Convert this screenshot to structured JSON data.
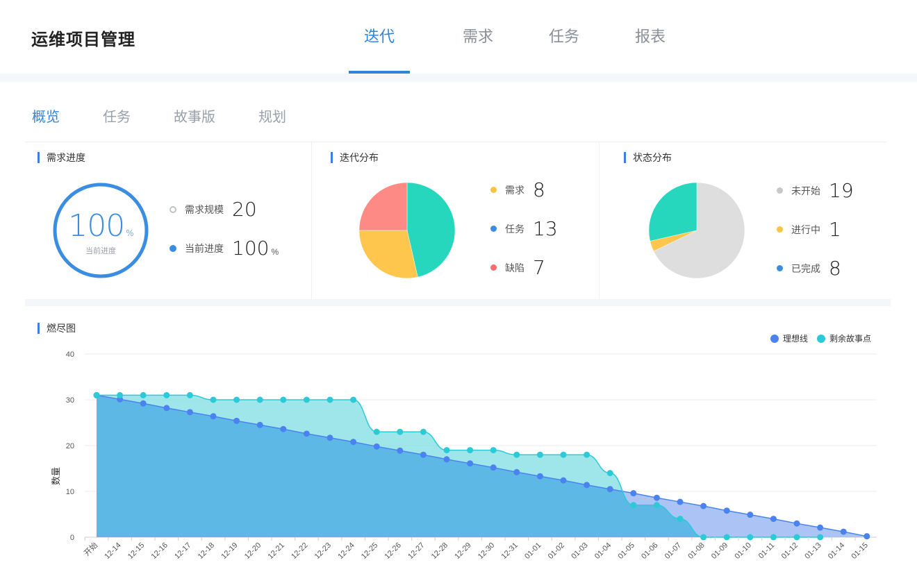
{
  "app": {
    "title": "运维项目管理"
  },
  "top_tabs": [
    {
      "label": "迭代",
      "active": true
    },
    {
      "label": "需求",
      "active": false
    },
    {
      "label": "任务",
      "active": false
    },
    {
      "label": "报表",
      "active": false
    }
  ],
  "sub_tabs": [
    {
      "label": "概览",
      "active": true
    },
    {
      "label": "任务",
      "active": false
    },
    {
      "label": "故事版",
      "active": false
    },
    {
      "label": "规划",
      "active": false
    }
  ],
  "demand_progress": {
    "title": "需求进度",
    "ring_value": "100",
    "ring_unit": "%",
    "ring_label": "当前进度",
    "progress_fraction": 1.0,
    "ring_color": "#3a8de0",
    "items": [
      {
        "label": "需求规模",
        "value": "20",
        "unit": ""
      },
      {
        "label": "当前进度",
        "value": "100",
        "unit": "%"
      }
    ]
  },
  "iteration_distribution": {
    "title": "迭代分布",
    "items": [
      {
        "label": "需求",
        "value": 8,
        "color": "#fbc343"
      },
      {
        "label": "任务",
        "value": 13,
        "color": "#3a8de0"
      },
      {
        "label": "缺陷",
        "value": 7,
        "color": "#f76c6c"
      }
    ],
    "slices": [
      {
        "name": "需求",
        "value": 8,
        "color": "#fec64c"
      },
      {
        "name": "任务",
        "value": 13,
        "color": "#26d6bd"
      },
      {
        "name": "缺陷",
        "value": 7,
        "color": "#fe8a86"
      }
    ]
  },
  "status_distribution": {
    "title": "状态分布",
    "items": [
      {
        "label": "未开始",
        "value": 19,
        "color": "#c8c8c8"
      },
      {
        "label": "进行中",
        "value": 1,
        "color": "#fbc343"
      },
      {
        "label": "已完成",
        "value": 8,
        "color": "#3a8de0"
      }
    ],
    "slices": [
      {
        "name": "未开始",
        "value": 19,
        "color": "#dedede"
      },
      {
        "name": "进行中",
        "value": 1,
        "color": "#fec64c"
      },
      {
        "name": "已完成",
        "value": 8,
        "color": "#26d6bd"
      }
    ]
  },
  "burndown": {
    "title": "燃尽图",
    "legend": [
      {
        "label": "理想线",
        "color": "#4a83f0"
      },
      {
        "label": "剩余故事点",
        "color": "#2bcad6"
      }
    ]
  },
  "chart_data": {
    "type": "area",
    "title": "燃尽图",
    "xlabel": "",
    "ylabel": "数量",
    "ylim": [
      0,
      40
    ],
    "yticks": [
      0,
      10,
      20,
      30,
      40
    ],
    "grid": true,
    "legend_position": "top-right",
    "categories": [
      "开始",
      "12-14",
      "12-15",
      "12-16",
      "12-17",
      "12-18",
      "12-19",
      "12-20",
      "12-21",
      "12-22",
      "12-23",
      "12-24",
      "12-25",
      "12-26",
      "12-27",
      "12-28",
      "12-29",
      "12-30",
      "12-31",
      "01-01",
      "01-02",
      "01-03",
      "01-04",
      "01-05",
      "01-06",
      "01-07",
      "01-08",
      "01-09",
      "01-10",
      "01-11",
      "01-12",
      "01-13",
      "01-14",
      "01-15"
    ],
    "series": [
      {
        "name": "理想线",
        "color": "#4a83f0",
        "values": [
          31,
          30.1,
          29.2,
          28.2,
          27.3,
          26.4,
          25.4,
          24.5,
          23.6,
          22.6,
          21.7,
          20.8,
          19.8,
          18.9,
          18.0,
          17.0,
          16.1,
          15.2,
          14.2,
          13.3,
          12.4,
          11.4,
          10.5,
          9.6,
          8.6,
          7.7,
          6.8,
          5.8,
          4.9,
          4.0,
          3.0,
          2.1,
          1.2,
          0.2
        ]
      },
      {
        "name": "剩余故事点",
        "color": "#2bcad6",
        "values": [
          31,
          31,
          31,
          31,
          31,
          30,
          30,
          30,
          30,
          30,
          30,
          30,
          23,
          23,
          23,
          19,
          19,
          19,
          18,
          18,
          18,
          18,
          14,
          7,
          7,
          4,
          0,
          0,
          0,
          0,
          0,
          0,
          null,
          null
        ]
      }
    ]
  }
}
